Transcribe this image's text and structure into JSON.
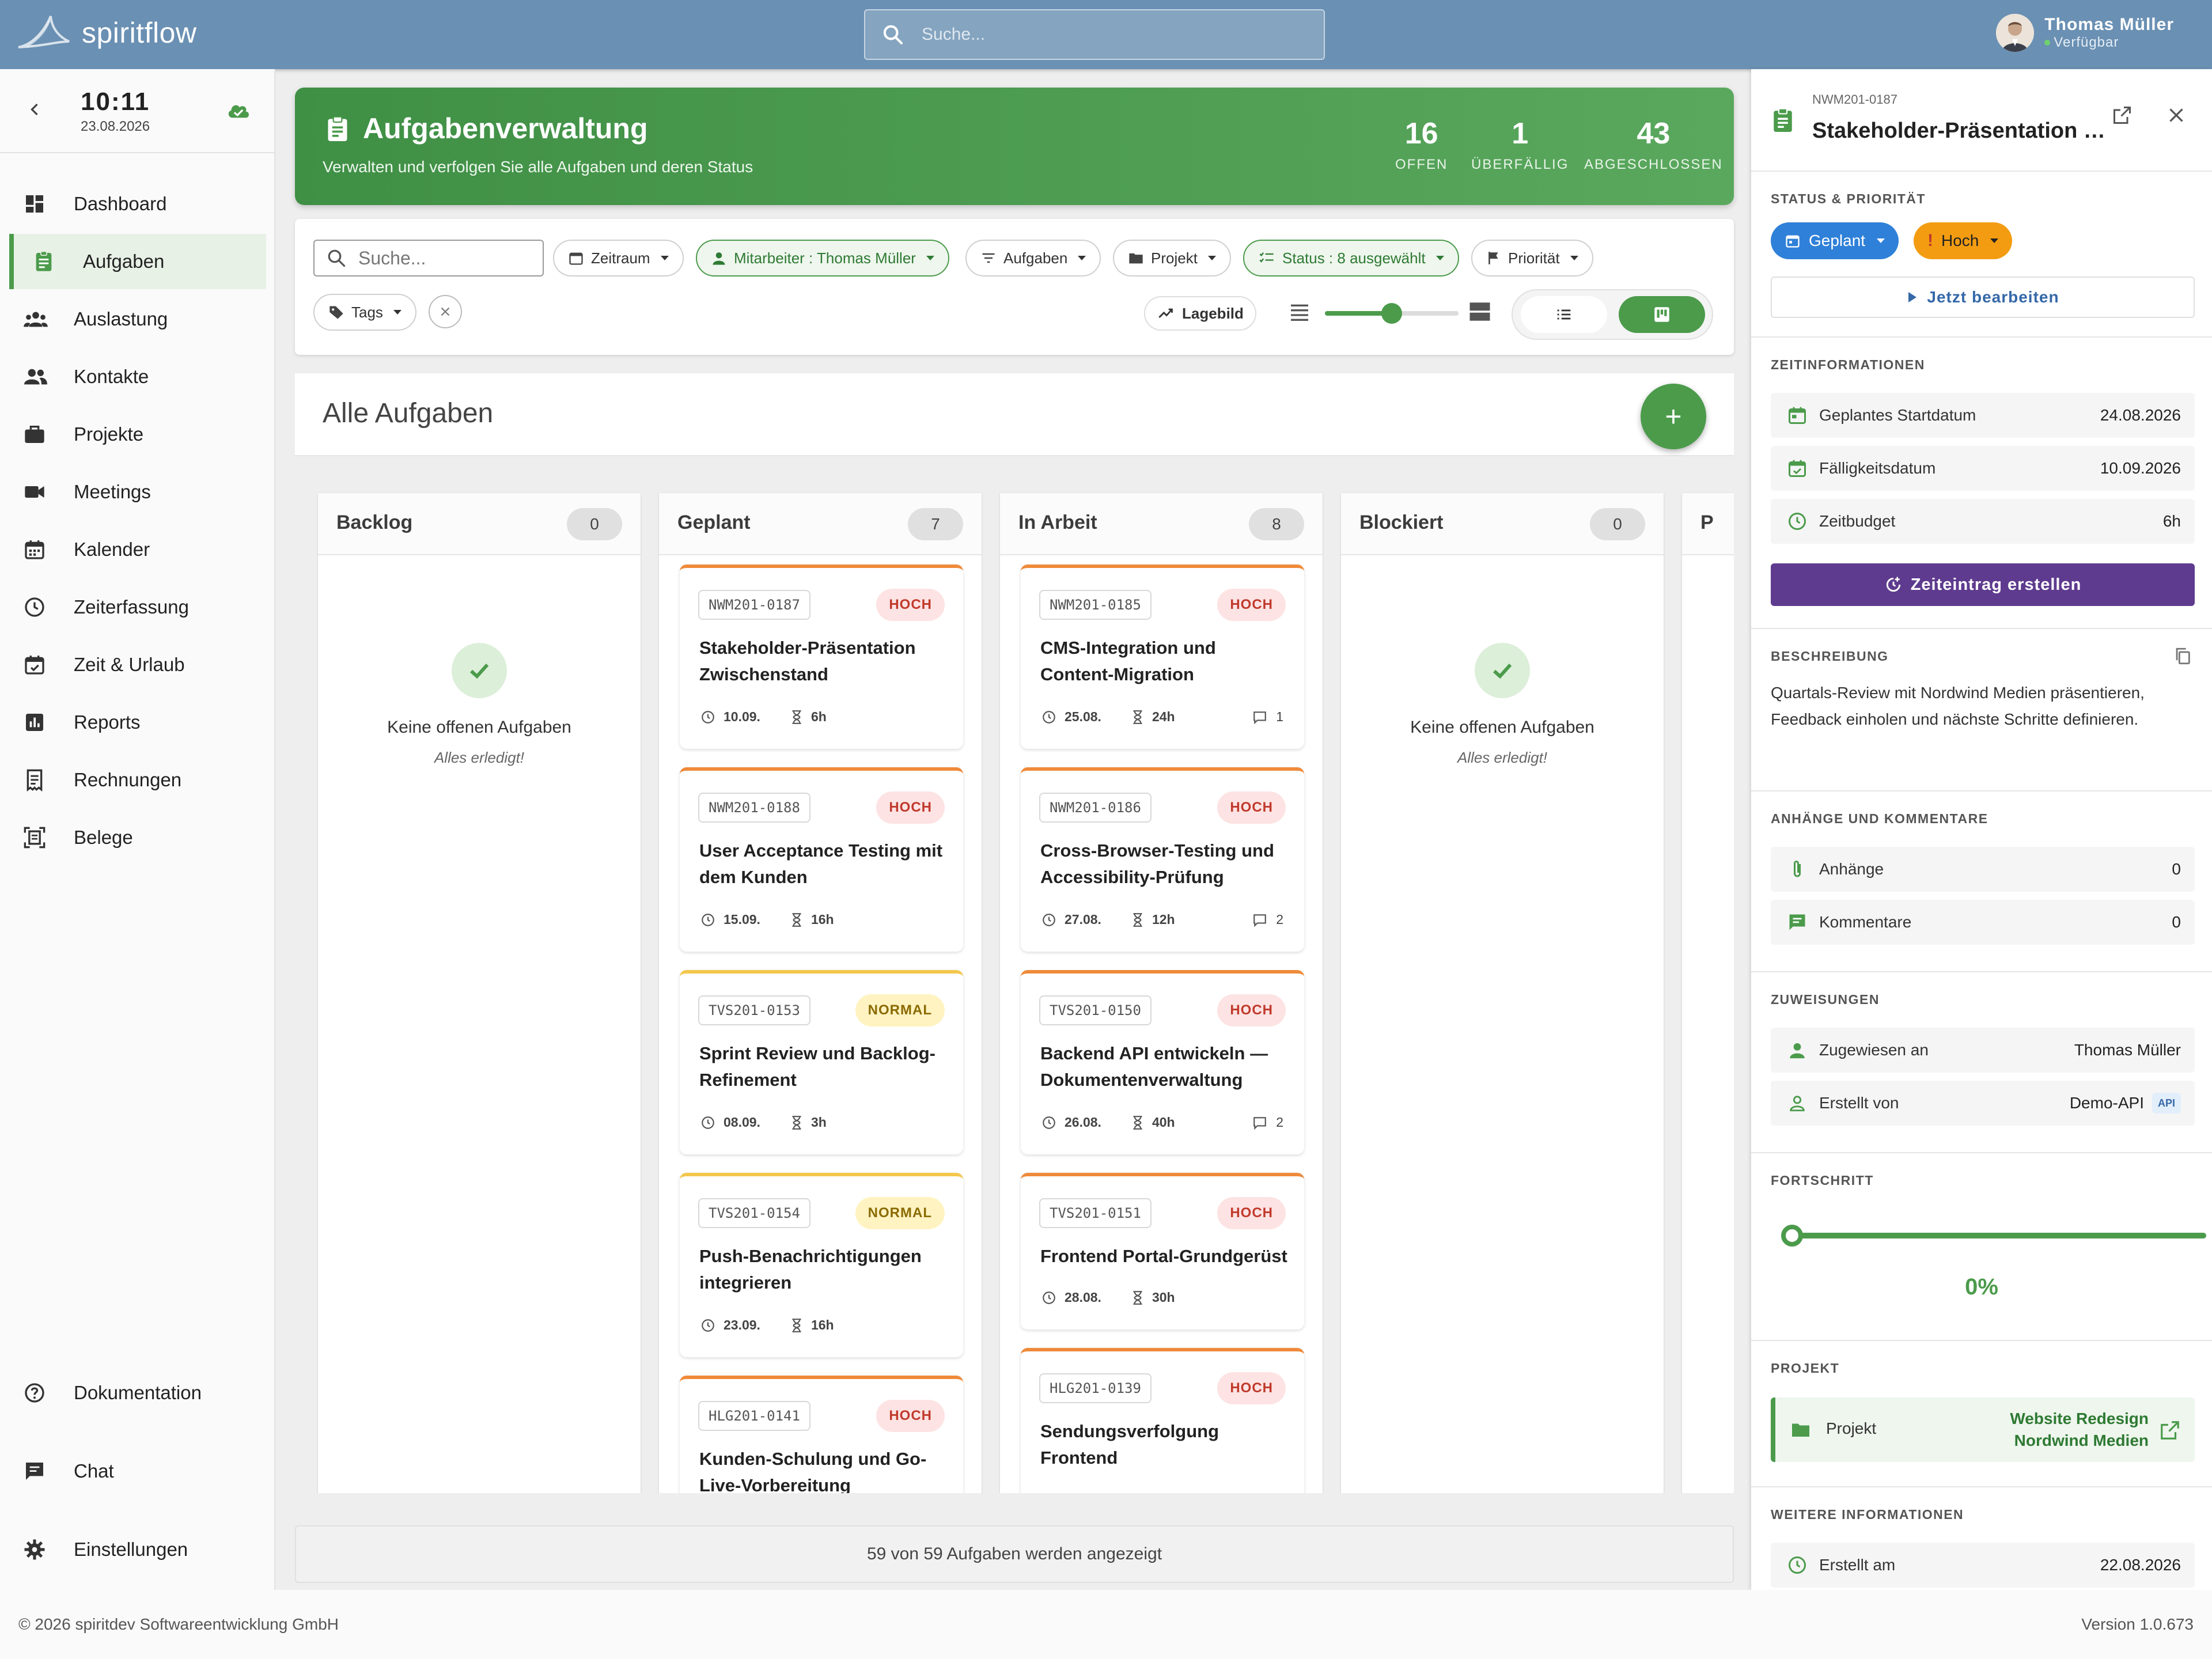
{
  "app": {
    "name": "spiritflow"
  },
  "search_top": {
    "placeholder": "Suche..."
  },
  "user": {
    "name": "Thomas Müller",
    "status": "Verfügbar"
  },
  "clock": {
    "time": "10:11",
    "date": "23.08.2026"
  },
  "nav": {
    "items": [
      {
        "label": "Dashboard"
      },
      {
        "label": "Aufgaben"
      },
      {
        "label": "Auslastung"
      },
      {
        "label": "Kontakte"
      },
      {
        "label": "Projekte"
      },
      {
        "label": "Meetings"
      },
      {
        "label": "Kalender"
      },
      {
        "label": "Zeiterfassung"
      },
      {
        "label": "Zeit & Urlaub"
      },
      {
        "label": "Reports"
      },
      {
        "label": "Rechnungen"
      },
      {
        "label": "Belege"
      }
    ],
    "bottom": [
      {
        "label": "Dokumentation"
      },
      {
        "label": "Chat"
      },
      {
        "label": "Einstellungen"
      }
    ]
  },
  "banner": {
    "title": "Aufgabenverwaltung",
    "subtitle": "Verwalten und verfolgen Sie alle Aufgaben und deren Status",
    "stats": [
      {
        "value": "16",
        "label": "OFFEN"
      },
      {
        "value": "1",
        "label": "ÜBERFÄLLIG"
      },
      {
        "value": "43",
        "label": "ABGESCHLOSSEN"
      }
    ]
  },
  "filters": {
    "search_placeholder": "Suche...",
    "zeitraum": "Zeitraum",
    "mitarbeiter": "Mitarbeiter : Thomas Müller",
    "aufgaben": "Aufgaben",
    "projekt": "Projekt",
    "status": "Status : 8 ausgewählt",
    "prioritaet": "Priorität",
    "tags": "Tags",
    "lagebild": "Lagebild",
    "card_size_fraction": 0.5
  },
  "board": {
    "title": "Alle Aufgaben",
    "add_label": "+",
    "empty_title": "Keine offenen Aufgaben",
    "empty_sub": "Alles erledigt!",
    "footer": "59 von 59 Aufgaben werden angezeigt",
    "columns": [
      {
        "name": "Backlog",
        "count": "0"
      },
      {
        "name": "Geplant",
        "count": "7"
      },
      {
        "name": "In Arbeit",
        "count": "8"
      },
      {
        "name": "Blockiert",
        "count": "0"
      },
      {
        "name": "P",
        "count": ""
      }
    ],
    "geplant_cards": [
      {
        "id": "NWM201-0187",
        "priority": "HOCH",
        "title": "Stakeholder-Präsentation Zwischenstand",
        "date": "10.09.",
        "hours": "6h",
        "comments": ""
      },
      {
        "id": "NWM201-0188",
        "priority": "HOCH",
        "title": "User Acceptance Testing mit dem Kunden",
        "date": "15.09.",
        "hours": "16h",
        "comments": ""
      },
      {
        "id": "TVS201-0153",
        "priority": "NORMAL",
        "title": "Sprint Review und Backlog-Refinement",
        "date": "08.09.",
        "hours": "3h",
        "comments": ""
      },
      {
        "id": "TVS201-0154",
        "priority": "NORMAL",
        "title": "Push-Benachrichtigungen integrieren",
        "date": "23.09.",
        "hours": "16h",
        "comments": ""
      },
      {
        "id": "HLG201-0141",
        "priority": "HOCH",
        "title": "Kunden-Schulung und Go-Live-Vorbereitung",
        "date": "",
        "hours": "",
        "comments": ""
      }
    ],
    "arbeit_cards": [
      {
        "id": "NWM201-0185",
        "priority": "HOCH",
        "title": "CMS-Integration und Content-Migration",
        "date": "25.08.",
        "hours": "24h",
        "comments": "1"
      },
      {
        "id": "NWM201-0186",
        "priority": "HOCH",
        "title": "Cross-Browser-Testing und Accessibility-Prüfung",
        "date": "27.08.",
        "hours": "12h",
        "comments": "2"
      },
      {
        "id": "TVS201-0150",
        "priority": "HOCH",
        "title": "Backend API entwickeln — Dokumentenverwaltung",
        "date": "26.08.",
        "hours": "40h",
        "comments": "2"
      },
      {
        "id": "TVS201-0151",
        "priority": "HOCH",
        "title": "Frontend Portal-Grundgerüst",
        "date": "28.08.",
        "hours": "30h",
        "comments": ""
      },
      {
        "id": "HLG201-0139",
        "priority": "HOCH",
        "title": "Sendungsverfolgung Frontend",
        "date": "",
        "hours": "",
        "comments": ""
      }
    ]
  },
  "panel": {
    "id": "NWM201-0187",
    "title": "Stakeholder-Präsentation Zwischenstand",
    "status_section": "STATUS & PRIORITÄT",
    "status": "Geplant",
    "priority": "Hoch",
    "edit_button": "Jetzt bearbeiten",
    "time_section": "ZEITINFORMATIONEN",
    "start_label": "Geplantes Startdatum",
    "start_value": "24.08.2026",
    "due_label": "Fälligkeitsdatum",
    "due_value": "10.09.2026",
    "budget_label": "Zeitbudget",
    "budget_value": "6h",
    "time_button": "Zeiteintrag erstellen",
    "desc_section": "BESCHREIBUNG",
    "description": "Quartals-Review mit Nordwind Medien präsentieren, Feedback einholen und nächste Schritte definieren.",
    "attach_section": "ANHÄNGE UND KOMMENTARE",
    "attach_label": "Anhänge",
    "attach_value": "0",
    "comments_label": "Kommentare",
    "comments_value": "0",
    "assign_section": "ZUWEISUNGEN",
    "assigned_label": "Zugewiesen an",
    "assigned_value": "Thomas Müller",
    "created_by_label": "Erstellt von",
    "created_by_value": "Demo-API",
    "api_badge": "API",
    "progress_section": "FORTSCHRITT",
    "progress_value": "0%",
    "progress_fraction": 0,
    "project_section": "PROJEKT",
    "project_label": "Projekt",
    "project_value": "Website Redesign Nordwind Medien",
    "more_section": "WEITERE INFORMATIONEN",
    "created_at_label": "Erstellt am",
    "created_at_value": "22.08.2026"
  },
  "footer": {
    "copyright": "© 2026 spiritdev Softwareentwicklung GmbH",
    "version": "Version 1.0.673"
  },
  "colors": {
    "accent": "#4b9b4b",
    "topbar": "#6a90b3",
    "status_blue": "#2f80d8",
    "priority_orange": "#f39c12",
    "time_button": "#5e3b8e"
  }
}
